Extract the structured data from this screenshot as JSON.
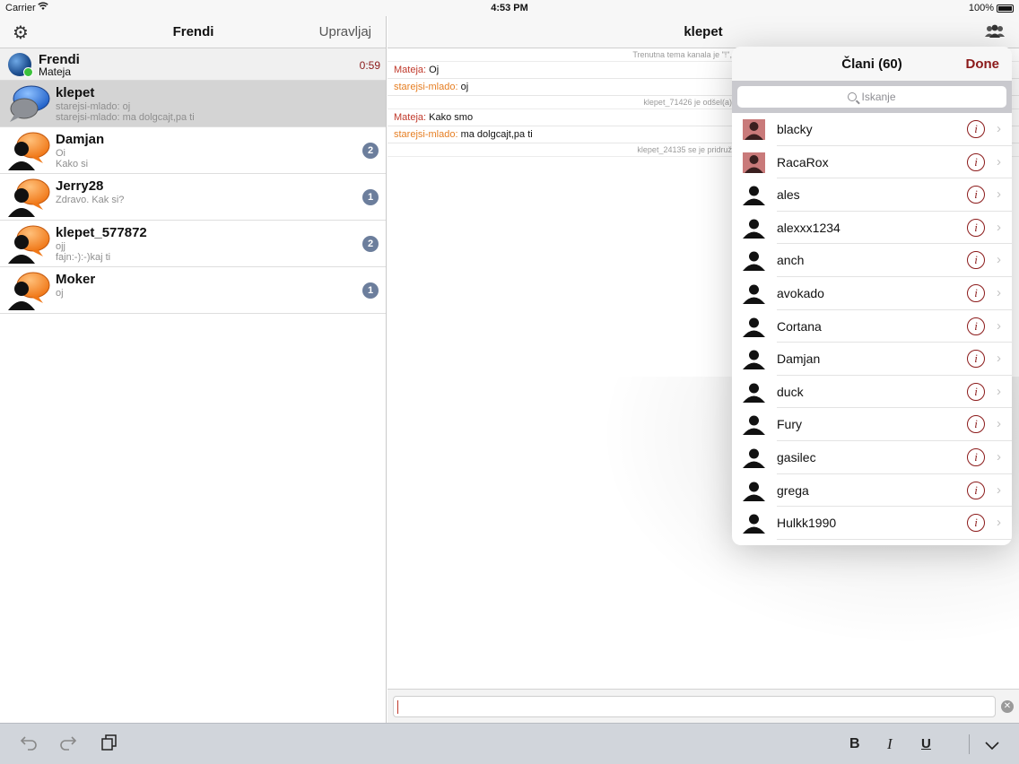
{
  "status_bar": {
    "carrier": "Carrier",
    "time": "4:53 PM",
    "battery": "100%"
  },
  "left": {
    "title": "Frendi",
    "manage_label": "Upravljaj",
    "account": {
      "name": "Frendi",
      "user": "Mateja",
      "duration": "0:59"
    },
    "chats": [
      {
        "name": "klepet",
        "line1": "starejsi-mlado: oj",
        "line2": "starejsi-mlado: ma dolgcajt,pa ti",
        "badge": "",
        "icon": "blue-bubble-icon",
        "selected": true
      },
      {
        "name": "Damjan",
        "line1": "Oi",
        "line2": "Kako si",
        "badge": "2",
        "icon": "orange-person-icon"
      },
      {
        "name": "Jerry28",
        "line1": "Zdravo. Kak si?",
        "line2": "",
        "badge": "1",
        "icon": "orange-person-icon"
      },
      {
        "name": "klepet_577872",
        "line1": "ojj",
        "line2": "fajn:-):-)kaj ti",
        "badge": "2",
        "icon": "orange-person-icon"
      },
      {
        "name": "Moker",
        "line1": "oj",
        "line2": "",
        "badge": "1",
        "icon": "orange-person-icon"
      }
    ]
  },
  "right": {
    "title": "klepet",
    "messages": [
      {
        "type": "system",
        "text": "Trenutna tema kanala je \"!\","
      },
      {
        "type": "msg",
        "sender": "Mateja",
        "text": "Oj",
        "color": "#c0392b"
      },
      {
        "type": "msg",
        "sender": "starejsi-mlado",
        "text": "oj",
        "color": "#e67e22"
      },
      {
        "type": "system",
        "text": "klepet_71426 je odšel(a)"
      },
      {
        "type": "msg",
        "sender": "Mateja",
        "text": "Kako smo",
        "color": "#c0392b"
      },
      {
        "type": "msg",
        "sender": "starejsi-mlado",
        "text": "ma dolgcajt,pa ti",
        "color": "#e67e22"
      },
      {
        "type": "system",
        "text": "klepet_24135 se je pridruž"
      }
    ]
  },
  "popover": {
    "title": "Člani (60)",
    "done_label": "Done",
    "search_placeholder": "Iskanje",
    "members": [
      {
        "name": "blacky",
        "avatar": "photo"
      },
      {
        "name": "RacaRox",
        "avatar": "photo"
      },
      {
        "name": "ales",
        "avatar": "silhouette"
      },
      {
        "name": "alexxx1234",
        "avatar": "silhouette"
      },
      {
        "name": "anch",
        "avatar": "silhouette"
      },
      {
        "name": "avokado",
        "avatar": "silhouette"
      },
      {
        "name": "Cortana",
        "avatar": "silhouette"
      },
      {
        "name": "Damjan",
        "avatar": "silhouette"
      },
      {
        "name": "duck",
        "avatar": "silhouette"
      },
      {
        "name": "Fury",
        "avatar": "silhouette"
      },
      {
        "name": "gasilec",
        "avatar": "silhouette"
      },
      {
        "name": "grega",
        "avatar": "silhouette"
      },
      {
        "name": "Hulkk1990",
        "avatar": "silhouette"
      }
    ]
  },
  "toolbar": {
    "bold_label": "B",
    "italic_label": "I",
    "underline_label": "U"
  },
  "colors": {
    "accent": "#8b1a1a",
    "sender_self": "#c0392b",
    "sender_other": "#e67e22",
    "badge": "#6c7e9c"
  }
}
